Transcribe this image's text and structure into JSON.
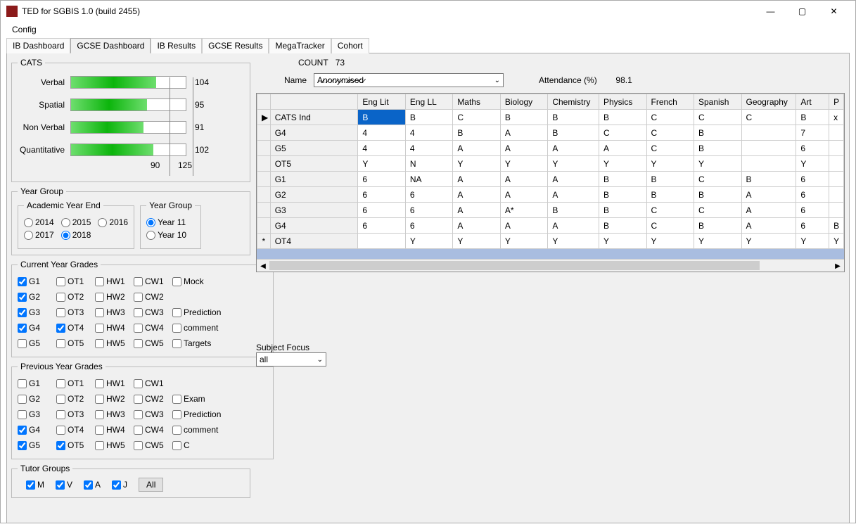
{
  "window": {
    "title": "TED for SGBIS 1.0 (build 2455)"
  },
  "menu": {
    "config": "Config"
  },
  "tabs": [
    "IB Dashboard",
    "GCSE Dashboard",
    "IB Results",
    "GCSE Results",
    "MegaTracker",
    "Cohort"
  ],
  "active_tab": 1,
  "cats": {
    "legend": "CATS",
    "rows": [
      {
        "label": "Verbal",
        "value": 104,
        "pct": 74
      },
      {
        "label": "Spatial",
        "value": 95,
        "pct": 66
      },
      {
        "label": "Non Verbal",
        "value": 91,
        "pct": 63
      },
      {
        "label": "Quantitative",
        "value": 102,
        "pct": 72
      }
    ],
    "axis": [
      "90",
      "125"
    ]
  },
  "year_group": {
    "legend": "Year Group",
    "academic_legend": "Academic Year End",
    "years": [
      "2014",
      "2015",
      "2016",
      "2017",
      "2018"
    ],
    "selected_year": "2018",
    "yg_legend": "Year Group",
    "groups": [
      "Year 11",
      "Year 10"
    ],
    "selected_group": "Year 11"
  },
  "current_grades": {
    "legend": "Current Year Grades",
    "rows": [
      [
        [
          "G1",
          true
        ],
        [
          "OT1",
          false
        ],
        [
          "HW1",
          false
        ],
        [
          "CW1",
          false
        ],
        [
          "Mock",
          false
        ]
      ],
      [
        [
          "G2",
          true
        ],
        [
          "OT2",
          false
        ],
        [
          "HW2",
          false
        ],
        [
          "CW2",
          false
        ]
      ],
      [
        [
          "G3",
          true
        ],
        [
          "OT3",
          false
        ],
        [
          "HW3",
          false
        ],
        [
          "CW3",
          false
        ],
        [
          "Prediction",
          false
        ]
      ],
      [
        [
          "G4",
          true
        ],
        [
          "OT4",
          true
        ],
        [
          "HW4",
          false
        ],
        [
          "CW4",
          false
        ],
        [
          "comment",
          false
        ]
      ],
      [
        [
          "G5",
          false
        ],
        [
          "OT5",
          false
        ],
        [
          "HW5",
          false
        ],
        [
          "CW5",
          false
        ],
        [
          "Targets",
          false
        ]
      ]
    ]
  },
  "previous_grades": {
    "legend": "Previous Year Grades",
    "rows": [
      [
        [
          "G1",
          false
        ],
        [
          "OT1",
          false
        ],
        [
          "HW1",
          false
        ],
        [
          "CW1",
          false
        ]
      ],
      [
        [
          "G2",
          false
        ],
        [
          "OT2",
          false
        ],
        [
          "HW2",
          false
        ],
        [
          "CW2",
          false
        ],
        [
          "Exam",
          false
        ]
      ],
      [
        [
          "G3",
          false
        ],
        [
          "OT3",
          false
        ],
        [
          "HW3",
          false
        ],
        [
          "CW3",
          false
        ],
        [
          "Prediction",
          false
        ]
      ],
      [
        [
          "G4",
          true
        ],
        [
          "OT4",
          false
        ],
        [
          "HW4",
          false
        ],
        [
          "CW4",
          false
        ],
        [
          "comment",
          false
        ]
      ],
      [
        [
          "G5",
          true
        ],
        [
          "OT5",
          true
        ],
        [
          "HW5",
          false
        ],
        [
          "CW5",
          false
        ],
        [
          "C",
          false
        ]
      ]
    ]
  },
  "tutor_groups": {
    "legend": "Tutor Groups",
    "items": [
      [
        "M",
        true
      ],
      [
        "V",
        true
      ],
      [
        "A",
        true
      ],
      [
        "J",
        true
      ]
    ],
    "all_btn": "All"
  },
  "header": {
    "count_label": "COUNT",
    "count_value": "73",
    "name_label": "Name",
    "name_value": "A̷n̷o̷n̷y̷m̷i̷s̷e̷d̷",
    "attendance_label": "Attendance (%)",
    "attendance_value": "98.1"
  },
  "grid": {
    "columns": [
      "",
      "",
      "Eng Lit",
      "Eng LL",
      "Maths",
      "Biology",
      "Chemistry",
      "Physics",
      "French",
      "Spanish",
      "Geography",
      "Art",
      "P"
    ],
    "rows": [
      {
        "marker": "▶",
        "label": "CATS Ind",
        "cells": [
          "B",
          "B",
          "C",
          "B",
          "B",
          "B",
          "C",
          "C",
          "C",
          "B",
          "x"
        ],
        "selcol": 0
      },
      {
        "marker": "",
        "label": "G4",
        "cells": [
          "4",
          "4",
          "B",
          "A",
          "B",
          "C",
          "C",
          "B",
          "",
          "7",
          ""
        ]
      },
      {
        "marker": "",
        "label": "G5",
        "cells": [
          "4",
          "4",
          "A",
          "A",
          "A",
          "A",
          "C",
          "B",
          "",
          "6",
          ""
        ]
      },
      {
        "marker": "",
        "label": "OT5",
        "cells": [
          "Y",
          "N",
          "Y",
          "Y",
          "Y",
          "Y",
          "Y",
          "Y",
          "",
          "Y",
          ""
        ]
      },
      {
        "marker": "",
        "label": "G1",
        "cells": [
          "6",
          "NA",
          "A",
          "A",
          "A",
          "B",
          "B",
          "C",
          "B",
          "6",
          ""
        ]
      },
      {
        "marker": "",
        "label": "G2",
        "cells": [
          "6",
          "6",
          "A",
          "A",
          "A",
          "B",
          "B",
          "B",
          "A",
          "6",
          ""
        ]
      },
      {
        "marker": "",
        "label": "G3",
        "cells": [
          "6",
          "6",
          "A",
          "A*",
          "B",
          "B",
          "C",
          "C",
          "A",
          "6",
          ""
        ]
      },
      {
        "marker": "",
        "label": "G4",
        "cells": [
          "6",
          "6",
          "A",
          "A",
          "A",
          "B",
          "C",
          "B",
          "A",
          "6",
          "B"
        ]
      },
      {
        "marker": "*",
        "label": "OT4",
        "cells": [
          "",
          "Y",
          "Y",
          "Y",
          "Y",
          "Y",
          "Y",
          "Y",
          "Y",
          "Y",
          "Y"
        ]
      }
    ]
  },
  "subject_focus": {
    "label": "Subject Focus",
    "value": "all"
  }
}
